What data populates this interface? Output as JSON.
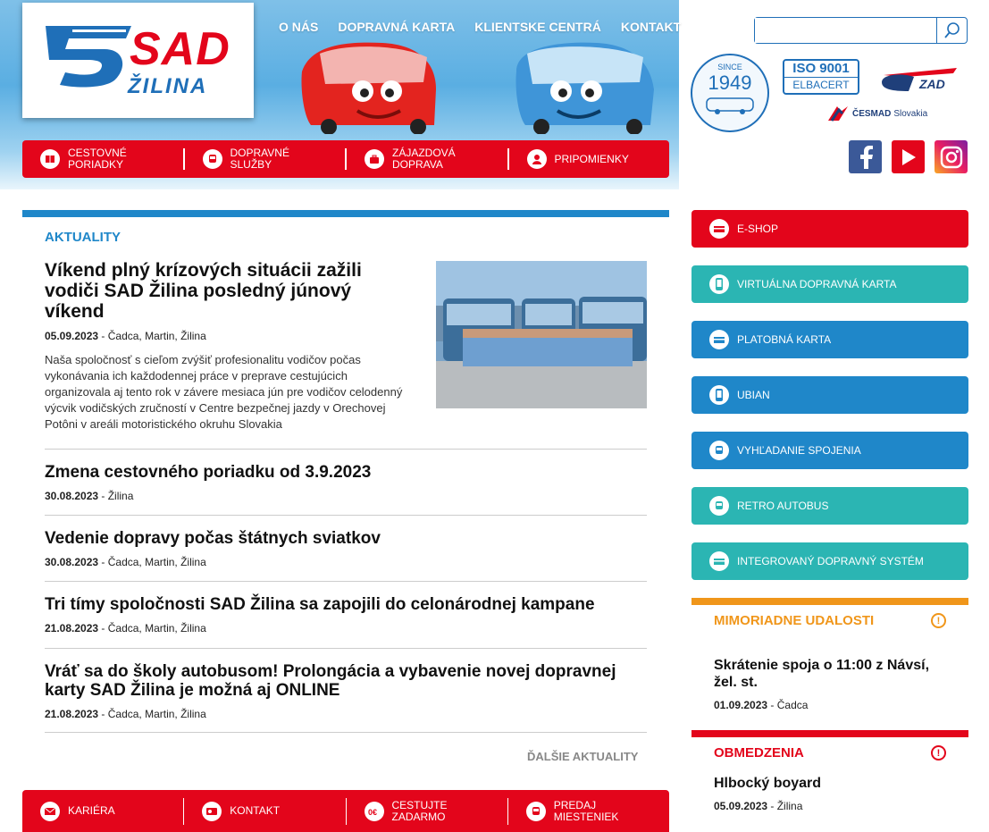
{
  "logo": {
    "brand": "SAD",
    "city": "ŽILINA"
  },
  "topnav": [
    "O NÁS",
    "DOPRAVNÁ KARTA",
    "KLIENTSKE CENTRÁ",
    "KONTAKT"
  ],
  "search": {
    "placeholder": "",
    "icon": "search-icon"
  },
  "badges": {
    "since_label": "SINCE",
    "since_year": "1949",
    "iso": "ISO 9001",
    "iso_sub": "ELBACERT",
    "zad": "ZAD",
    "cesmad": "ČESMAD",
    "cesmad_sub": "Slovakia"
  },
  "socials": [
    "facebook-icon",
    "youtube-icon",
    "instagram-icon"
  ],
  "rednav": [
    {
      "line1": "CESTOVNÉ",
      "line2": "PORIADKY",
      "icon": "book-icon"
    },
    {
      "line1": "DOPRAVNÉ",
      "line2": "SLUŽBY",
      "icon": "bus-icon"
    },
    {
      "line1": "ZÁJAZDOVÁ",
      "line2": "DOPRAVA",
      "icon": "suitcase-icon"
    },
    {
      "line1": "PRIPOMIENKY",
      "line2": "",
      "icon": "user-icon"
    }
  ],
  "main": {
    "section_title": "AKTUALITY",
    "featured": {
      "title": "Víkend plný krízových situácii zažili vodiči SAD Žilina posledný júnový víkend",
      "date": "05.09.2023",
      "places": " - Čadca, Martin, Žilina",
      "body": "Naša spoločnosť s cieľom zvýšiť profesionalitu vodičov počas vykonávania ich každodennej práce v preprave cestujúcich organizovala aj tento rok v závere mesiaca jún pre vodičov celodenný výcvik vodičských zručností v Centre bezpečnej jazdy v Orechovej Potôni v areáli motoristického okruhu Slovakia"
    },
    "news": [
      {
        "title": "Zmena cestovného poriadku od 3.9.2023",
        "date": "30.08.2023",
        "places": " - Žilina"
      },
      {
        "title": "Vedenie dopravy počas štátnych sviatkov",
        "date": "30.08.2023",
        "places": " - Čadca, Martin, Žilina"
      },
      {
        "title": "Tri tímy spoločnosti SAD Žilina sa zapojili do celonárodnej kampane",
        "date": "21.08.2023",
        "places": " - Čadca, Martin, Žilina"
      },
      {
        "title": "Vráť sa do školy autobusom! Prolongácia a vybavenie novej dopravnej karty SAD Žilina je možná aj ONLINE",
        "date": "21.08.2023",
        "places": " - Čadca, Martin, Žilina"
      }
    ],
    "more": "ĎALŠIE AKTUALITY"
  },
  "botnav": [
    {
      "line1": "KARIÉRA",
      "line2": "",
      "icon": "mail-icon"
    },
    {
      "line1": "KONTAKT",
      "line2": "",
      "icon": "contact-icon"
    },
    {
      "line1": "CESTUJTE",
      "line2": "ZADARMO",
      "icon": "euro-icon"
    },
    {
      "line1": "PREDAJ",
      "line2": "MIESTENIEK",
      "icon": "bus-icon"
    }
  ],
  "sidebar": [
    {
      "label": "E-SHOP",
      "color": "#e3051b",
      "icon": "card-icon"
    },
    {
      "label": "VIRTUÁLNA DOPRAVNÁ KARTA",
      "color": "#2bb5b3",
      "icon": "phone-icon"
    },
    {
      "label": "PLATOBNÁ KARTA",
      "color": "#1f87c9",
      "icon": "card-icon"
    },
    {
      "label": "UBIAN",
      "color": "#1f87c9",
      "icon": "phone-icon"
    },
    {
      "label": "VYHĽADANIE SPOJENIA",
      "color": "#1f87c9",
      "icon": "bus-icon"
    },
    {
      "label": "RETRO AUTOBUS",
      "color": "#2bb5b3",
      "icon": "bus-icon"
    },
    {
      "label": "INTEGROVANÝ DOPRAVNÝ SYSTÉM",
      "color": "#2bb5b3",
      "icon": "card-icon"
    }
  ],
  "alerts": [
    {
      "title": "MIMORIADNE UDALOSTI",
      "color": "#f0961a",
      "item": "Skrátenie spoja o 11:00 z Návsí, žel. st.",
      "date": "01.09.2023",
      "places": " - Čadca"
    },
    {
      "title": "OBMEDZENIA",
      "color": "#e3051b",
      "item": "Hlbocký boyard",
      "date": "05.09.2023",
      "places": " - Žilina"
    }
  ]
}
